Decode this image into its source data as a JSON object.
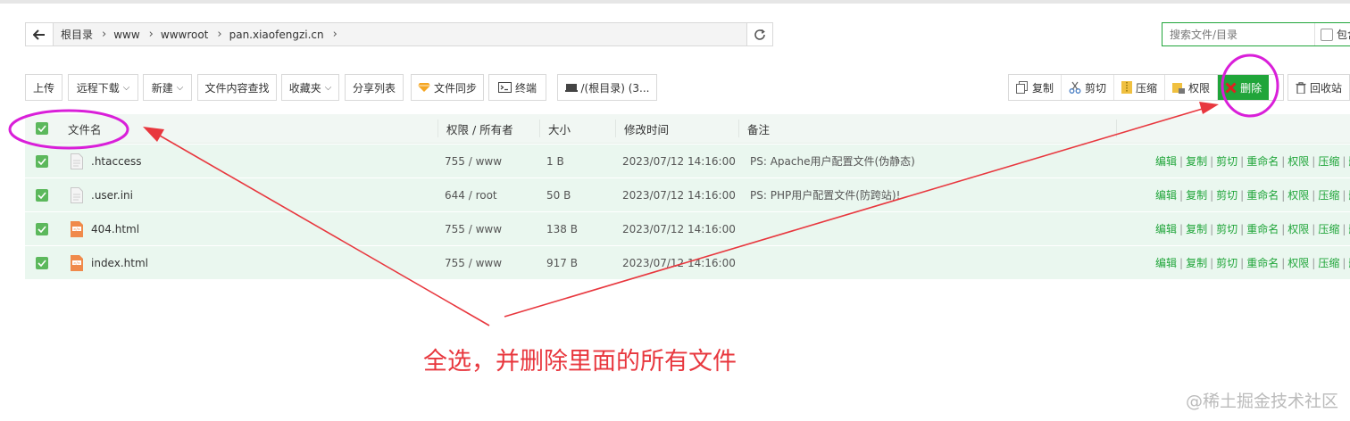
{
  "path": {
    "crumbs": [
      "根目录",
      "www",
      "wwwroot",
      "pan.xiaofengzi.cn"
    ]
  },
  "search": {
    "placeholder": "搜索文件/目录",
    "option_label": "包含"
  },
  "toolbar": {
    "upload": "上传",
    "remote_download": "远程下载",
    "new": "新建",
    "content_search": "文件内容查找",
    "favorites": "收藏夹",
    "share_list": "分享列表",
    "sync": "文件同步",
    "terminal": "终端",
    "disk": "/(根目录) (3...",
    "batch": {
      "copy": "复制",
      "cut": "剪切",
      "compress": "压缩",
      "perm": "权限",
      "delete": "删除",
      "recycle": "回收站"
    }
  },
  "table": {
    "headers": {
      "name": "文件名",
      "perm": "权限 / 所有者",
      "size": "大小",
      "mtime": "修改时间",
      "note": "备注"
    },
    "rows": [
      {
        "name": ".htaccess",
        "perm": "755 / www",
        "size": "1 B",
        "mtime": "2023/07/12 14:16:00",
        "note": "PS: Apache用户配置文件(伪静态)",
        "icon": "text-file-icon"
      },
      {
        "name": ".user.ini",
        "perm": "644 / root",
        "size": "50 B",
        "mtime": "2023/07/12 14:16:00",
        "note": "PS: PHP用户配置文件(防跨站)!",
        "icon": "text-file-icon"
      },
      {
        "name": "404.html",
        "perm": "755 / www",
        "size": "138 B",
        "mtime": "2023/07/12 14:16:00",
        "note": "",
        "icon": "html-file-icon"
      },
      {
        "name": "index.html",
        "perm": "755 / www",
        "size": "917 B",
        "mtime": "2023/07/12 14:16:00",
        "note": "",
        "icon": "html-file-icon"
      }
    ],
    "row_ops": [
      "编辑",
      "复制",
      "剪切",
      "重命名",
      "权限",
      "压缩",
      "删"
    ]
  },
  "annotation": {
    "text": "全选，并删除里面的所有文件",
    "color": "#e8373e",
    "highlight_color": "#d91fd9"
  },
  "watermark": "@稀土掘金技术社区",
  "colors": {
    "accent": "#20a53a",
    "row_bg": "#eaf7ef",
    "header_bg": "#f1f7f3"
  }
}
